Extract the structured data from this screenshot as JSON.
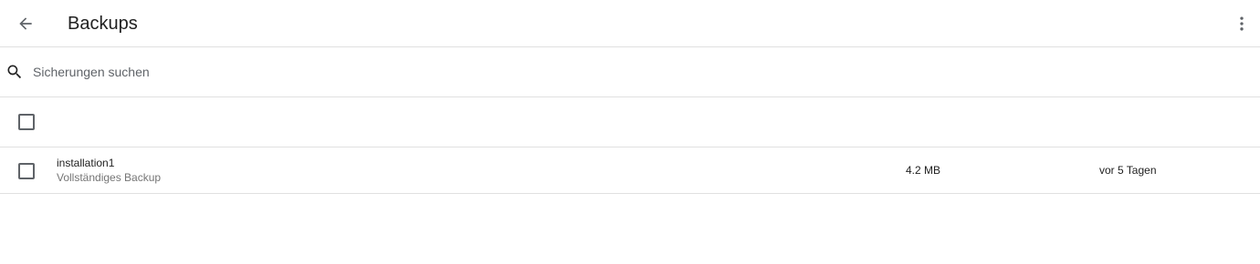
{
  "header": {
    "title": "Backups",
    "back_icon": "arrow-left-icon",
    "menu_icon": "more-vertical-icon"
  },
  "search": {
    "placeholder": "Sicherungen suchen",
    "value": "",
    "icon": "search-icon"
  },
  "table": {
    "select_all_checked": false,
    "rows": [
      {
        "checked": false,
        "name": "installation1",
        "type": "Vollständiges Backup",
        "size": "4.2 MB",
        "date": "vor 5 Tagen"
      }
    ]
  },
  "colors": {
    "text_primary": "#212121",
    "text_secondary": "#757575",
    "divider": "#e0e0e0",
    "icon": "#5f6368"
  }
}
